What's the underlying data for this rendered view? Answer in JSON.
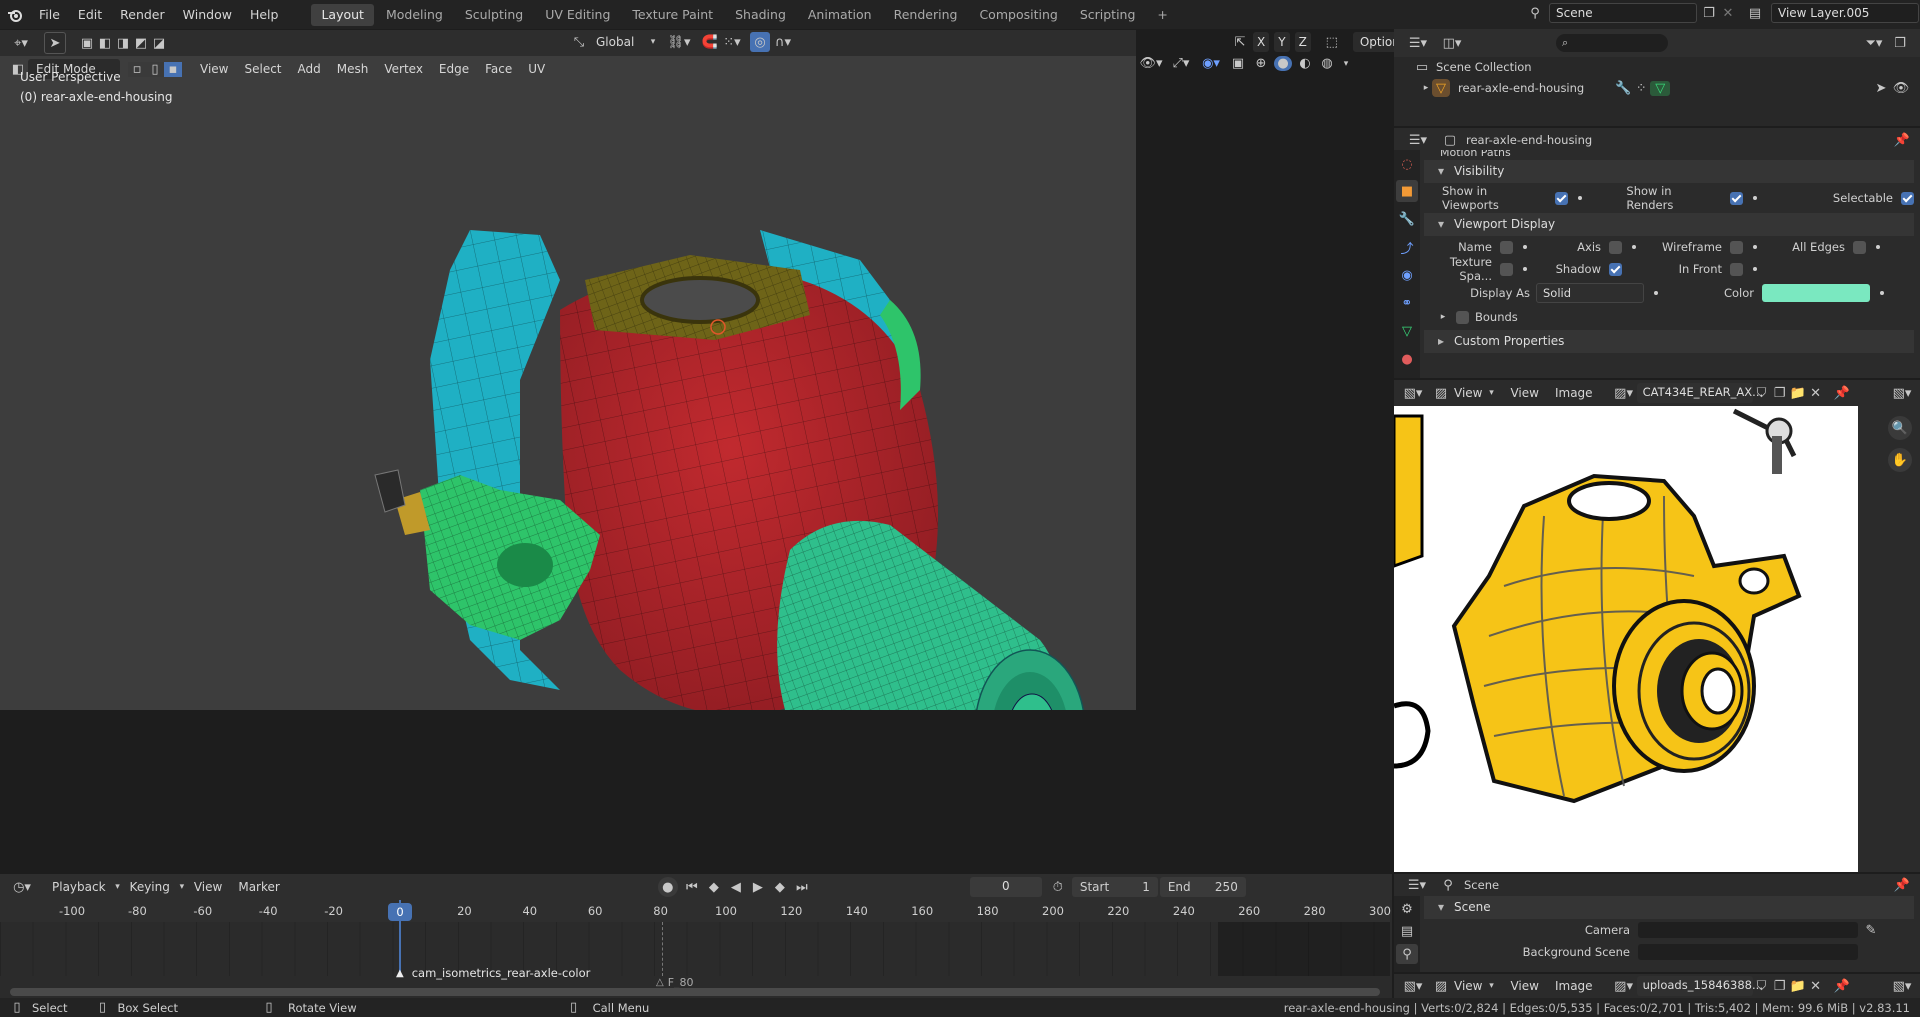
{
  "menubar": {
    "items": [
      "File",
      "Edit",
      "Render",
      "Window",
      "Help"
    ]
  },
  "workspaces": {
    "tabs": [
      "Layout",
      "Modeling",
      "Sculpting",
      "UV Editing",
      "Texture Paint",
      "Shading",
      "Animation",
      "Rendering",
      "Compositing",
      "Scripting"
    ],
    "active": "Layout",
    "add": "+"
  },
  "scene": {
    "name": "Scene",
    "view_layer": "View Layer.005"
  },
  "viewport": {
    "mode": "Edit Mode",
    "menus": [
      "View",
      "Select",
      "Add",
      "Mesh",
      "Vertex",
      "Edge",
      "Face",
      "UV"
    ],
    "transform": "Global",
    "axes": [
      "X",
      "Y",
      "Z"
    ],
    "options": "Options",
    "overlay_title": "User Perspective",
    "overlay_object": "(0) rear-axle-end-housing"
  },
  "outliner": {
    "search_placeholder": "",
    "root": "Scene Collection",
    "object": "rear-axle-end-housing"
  },
  "properties": {
    "object": "rear-axle-end-housing",
    "cut_section": "Motion Paths",
    "visibility": {
      "title": "Visibility",
      "show_in_viewports": "Show in Viewports",
      "show_in_renders": "Show in Renders",
      "selectable": "Selectable"
    },
    "viewport_display": {
      "title": "Viewport Display",
      "name": "Name",
      "axis": "Axis",
      "wireframe": "Wireframe",
      "all_edges": "All Edges",
      "texture_space": "Texture Spa...",
      "shadow": "Shadow",
      "in_front": "In Front",
      "display_as_label": "Display As",
      "display_as": "Solid",
      "color_label": "Color",
      "color": "#7ae8c0",
      "bounds": "Bounds"
    },
    "custom_properties": "Custom Properties"
  },
  "image_editor": {
    "menu_view": "View",
    "view": "View",
    "image": "Image",
    "image_name": "CAT434E_REAR_AX..."
  },
  "timeline": {
    "menus": [
      "Playback",
      "Keying",
      "View",
      "Marker"
    ],
    "current_frame": "0",
    "start_label": "Start",
    "start": "1",
    "end_label": "End",
    "end": "250",
    "ticks": [
      "-100",
      "-80",
      "-60",
      "-40",
      "-20",
      "0",
      "20",
      "40",
      "60",
      "80",
      "100",
      "120",
      "140",
      "160",
      "180",
      "200",
      "220",
      "240",
      "260",
      "280",
      "300"
    ],
    "marker1": "cam_isometrics_rear-axle-color",
    "marker2": "F_80"
  },
  "scene_props": {
    "title": "Scene",
    "section": "Scene",
    "camera": "Camera",
    "background_scene": "Background Scene"
  },
  "image_editor2": {
    "view": "View",
    "view2": "View",
    "image": "Image",
    "image_name": "uploads_15846388..."
  },
  "statusbar": {
    "select": "Select",
    "box_select": "Box Select",
    "rotate": "Rotate View",
    "call_menu": "Call Menu",
    "stats": "rear-axle-end-housing | Verts:0/2,824 | Edges:0/5,535 | Faces:0/2,701 | Tris:5,402 | Mem: 99.6 MiB | v2.83.11"
  },
  "colors": {
    "red": "#a8232a",
    "teal": "#1fb0c4",
    "green": "#2ec46a",
    "mint": "#2fbf8c",
    "olive": "#6e6418",
    "yellow": "#f6c417"
  }
}
